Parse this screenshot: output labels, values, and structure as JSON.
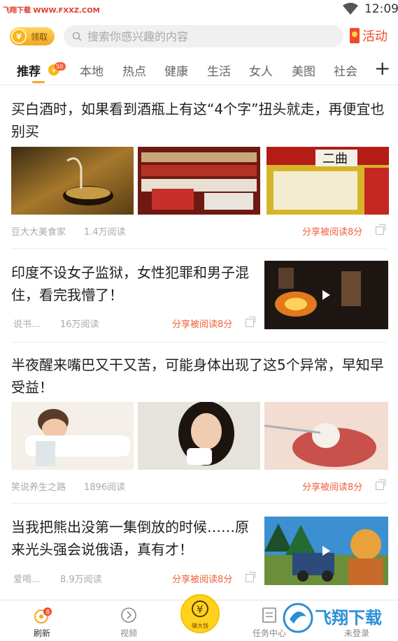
{
  "status_bar": {
    "watermark": "飞翔下载 WWW.FXXZ.COM",
    "time": "12:09"
  },
  "header": {
    "coin_label": "领取",
    "coin_symbol": "¥",
    "search_placeholder": "搜索你感兴趣的内容",
    "activity_label": "活动"
  },
  "tabs": [
    {
      "label": "推荐",
      "active": true,
      "badge": "50"
    },
    {
      "label": "本地"
    },
    {
      "label": "热点"
    },
    {
      "label": "健康"
    },
    {
      "label": "生活"
    },
    {
      "label": "女人"
    },
    {
      "label": "美图"
    },
    {
      "label": "社会"
    }
  ],
  "articles": [
    {
      "title": "买白酒时，如果看到酒瓶上有这“4个字”扭头就走，再便宜也别买",
      "source": "豆大大美食家",
      "reads": "1.4万阅读",
      "share": "分享被阅读8分"
    },
    {
      "title": "印度不设女子监狱，女性犯罪和男子混住，看完我懵了！",
      "source": "说书...",
      "reads": "16万阅读",
      "share": "分享被阅读8分"
    },
    {
      "title": "半夜醒来嘴巴又干又苦，可能身体出现了这5个异常，早知早受益！",
      "source": "笑说养生之路",
      "reads": "1896阅读",
      "share": "分享被阅读8分"
    },
    {
      "title": "当我把熊出没第一集倒放的时候……原来光头强会说俄语，真有才！",
      "source": "爱喝...",
      "reads": "8.9万阅读",
      "share": "分享被阅读8分"
    }
  ],
  "bottom_nav": {
    "refresh": {
      "label": "刷新",
      "badge": "8"
    },
    "video": {
      "label": "视频"
    },
    "earn": {
      "label": "赚大钱",
      "symbol": "¥"
    },
    "tasks": {
      "label": "任务中心"
    },
    "login": {
      "label": "未登录"
    }
  },
  "logo_watermark": "飞翔下载",
  "colors": {
    "accent_orange": "#f5a623",
    "share_red": "#f0603a",
    "activity_red": "#f04a2a"
  }
}
